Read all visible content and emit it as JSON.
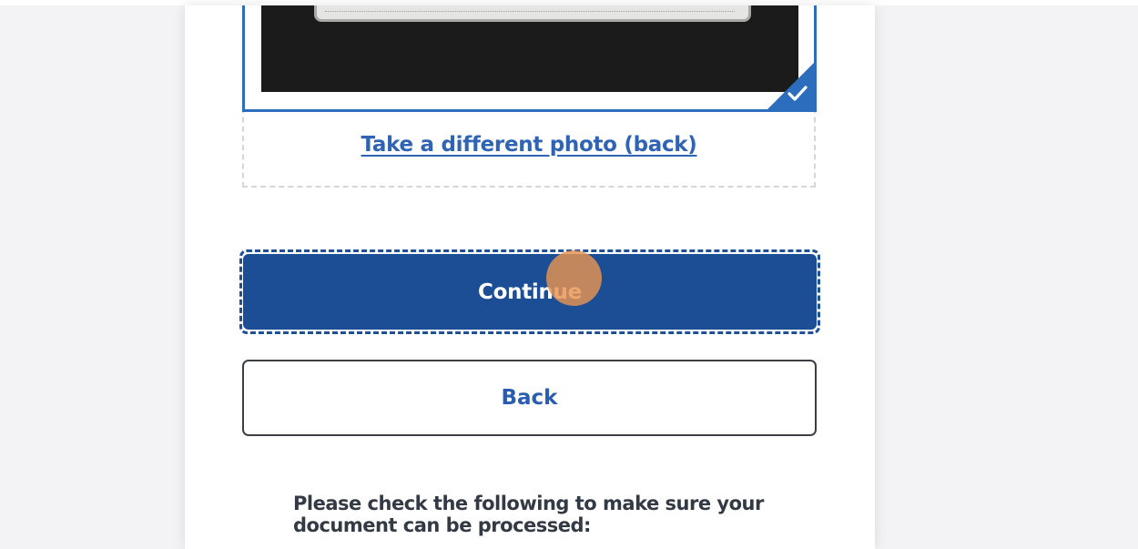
{
  "photo": {
    "retake_link": "Take a different photo (back)",
    "status_icon": "check-icon"
  },
  "actions": {
    "continue_label": "Continue",
    "back_label": "Back"
  },
  "instructions": {
    "heading": "Please check the following to make sure your document can be processed:"
  },
  "colors": {
    "primary": "#1c4e96",
    "accent": "#2c6ebd",
    "link": "#2f64b4",
    "click_indicator": "#e89450",
    "page_background": "#f3f3f5"
  }
}
